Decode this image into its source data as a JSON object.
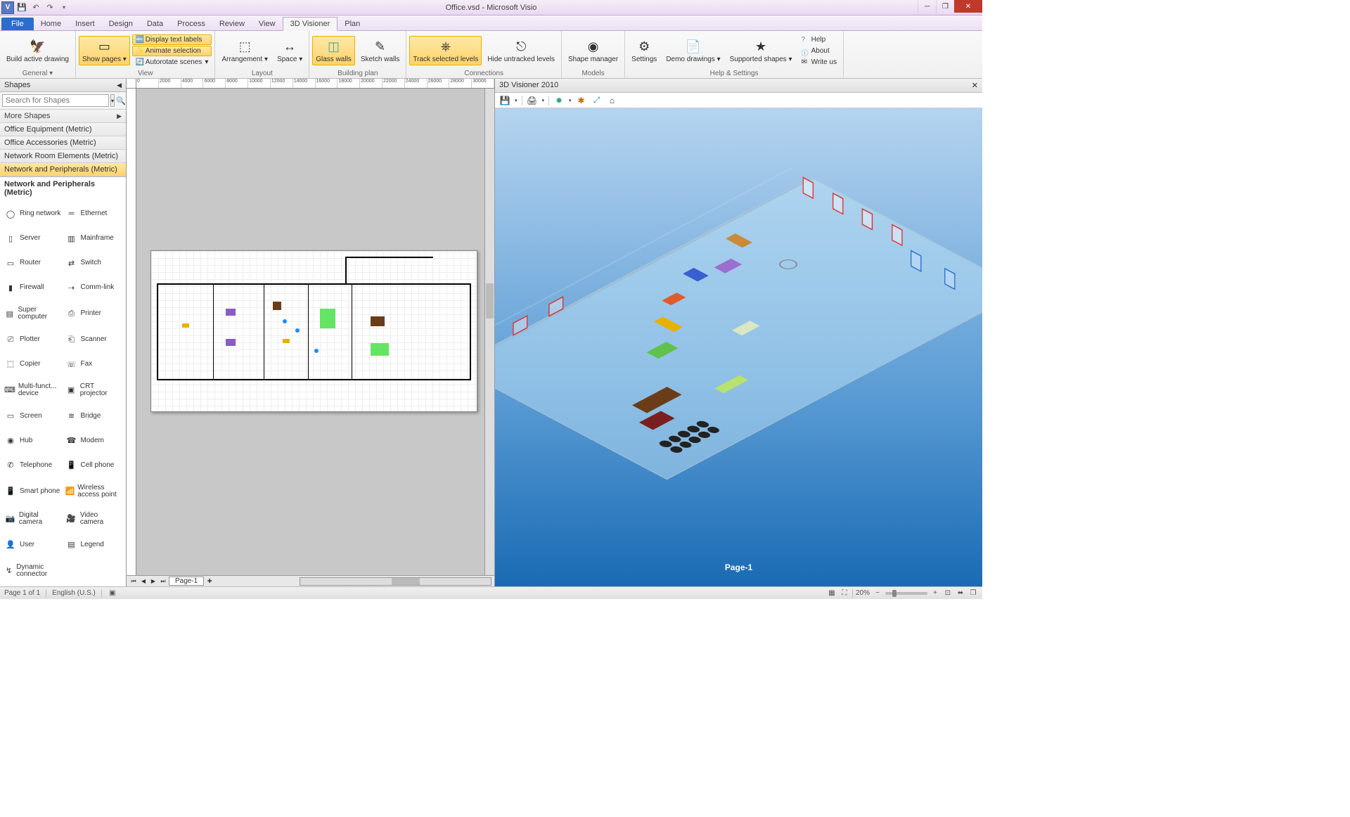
{
  "app": {
    "title": "Office.vsd - Microsoft Visio",
    "visioIcon": "V"
  },
  "tabs": {
    "file": "File",
    "items": [
      "Home",
      "Insert",
      "Design",
      "Data",
      "Process",
      "Review",
      "View",
      "3D Visioner",
      "Plan"
    ],
    "active": "3D Visioner"
  },
  "ribbon": {
    "general": {
      "label": "General",
      "buildActive": "Build active drawing"
    },
    "view": {
      "label": "View",
      "showPages": "Show pages",
      "displayTextLabels": "Display text labels",
      "animateSelection": "Animate selection",
      "autorotate": "Autorotate scenes"
    },
    "layout": {
      "label": "Layout",
      "arrangement": "Arrangement",
      "space": "Space"
    },
    "buildingPlan": {
      "label": "Building plan",
      "glassWalls": "Glass walls",
      "sketchWalls": "Sketch walls"
    },
    "connections": {
      "label": "Connections",
      "trackSelected": "Track selected levels",
      "hideUntracked": "Hide untracked levels"
    },
    "models": {
      "label": "Models",
      "shapeManager": "Shape manager"
    },
    "helpSettings": {
      "label": "Help & Settings",
      "settings": "Settings",
      "demoDrawings": "Demo drawings",
      "supportedShapes": "Supported shapes",
      "help": "Help",
      "about": "About",
      "writeUs": "Write us"
    }
  },
  "shapesPane": {
    "title": "Shapes",
    "searchPlaceholder": "Search for Shapes",
    "moreShapes": "More Shapes",
    "stencils": [
      "Office Equipment (Metric)",
      "Office Accessories (Metric)",
      "Network Room Elements (Metric)",
      "Network and Peripherals (Metric)"
    ],
    "selectedStencil": "Network and Peripherals (Metric)",
    "activeTitle": "Network and Peripherals (Metric)",
    "shapes": [
      {
        "n": "Ring network",
        "i": "ring"
      },
      {
        "n": "Ethernet",
        "i": "eth"
      },
      {
        "n": "Server",
        "i": "srv"
      },
      {
        "n": "Mainframe",
        "i": "mf"
      },
      {
        "n": "Router",
        "i": "rtr"
      },
      {
        "n": "Switch",
        "i": "sw"
      },
      {
        "n": "Firewall",
        "i": "fw"
      },
      {
        "n": "Comm-link",
        "i": "cl"
      },
      {
        "n": "Super computer",
        "i": "sc"
      },
      {
        "n": "Printer",
        "i": "prt"
      },
      {
        "n": "Plotter",
        "i": "plt"
      },
      {
        "n": "Scanner",
        "i": "scn"
      },
      {
        "n": "Copier",
        "i": "cp"
      },
      {
        "n": "Fax",
        "i": "fx"
      },
      {
        "n": "Multi-funct... device",
        "i": "mfd"
      },
      {
        "n": "CRT projector",
        "i": "crt"
      },
      {
        "n": "Screen",
        "i": "scr"
      },
      {
        "n": "Bridge",
        "i": "br"
      },
      {
        "n": "Hub",
        "i": "hub"
      },
      {
        "n": "Modem",
        "i": "mdm"
      },
      {
        "n": "Telephone",
        "i": "tel"
      },
      {
        "n": "Cell phone",
        "i": "cell"
      },
      {
        "n": "Smart phone",
        "i": "sp"
      },
      {
        "n": "Wireless access point",
        "i": "wap"
      },
      {
        "n": "Digital camera",
        "i": "dc"
      },
      {
        "n": "Video camera",
        "i": "vc"
      },
      {
        "n": "User",
        "i": "usr"
      },
      {
        "n": "Legend",
        "i": "lgd"
      },
      {
        "n": "Dynamic connector",
        "i": "dyn"
      }
    ]
  },
  "canvas": {
    "pageTab": "Page-1",
    "rulerHTicks": [
      "0",
      "2000",
      "4000",
      "6000",
      "8000",
      "10000",
      "12000",
      "14000",
      "16000",
      "18000",
      "20000",
      "22000",
      "24000",
      "26000",
      "28000",
      "30000"
    ]
  },
  "viewer": {
    "title": "3D Visioner 2010",
    "pageLabel": "Page-1"
  },
  "status": {
    "page": "Page 1 of 1",
    "lang": "English (U.S.)",
    "zoom": "20%"
  }
}
